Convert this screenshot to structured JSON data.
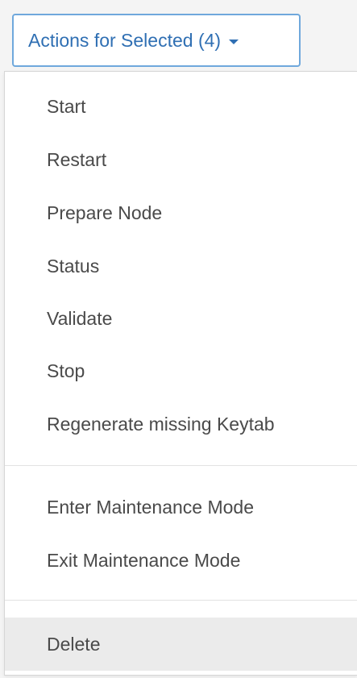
{
  "actions_button": {
    "label": "Actions for Selected (4)",
    "icon": "caret-down-icon",
    "color": "#2f6fb3",
    "border_color": "#6fa8dc"
  },
  "menu": {
    "group1": [
      {
        "label": "Start"
      },
      {
        "label": "Restart"
      },
      {
        "label": "Prepare Node"
      },
      {
        "label": "Status"
      },
      {
        "label": "Validate"
      },
      {
        "label": "Stop"
      },
      {
        "label": "Regenerate missing Keytab"
      }
    ],
    "group2": [
      {
        "label": "Enter Maintenance Mode"
      },
      {
        "label": "Exit Maintenance Mode"
      }
    ],
    "group3": [
      {
        "label": "Delete",
        "highlighted": true
      }
    ]
  }
}
